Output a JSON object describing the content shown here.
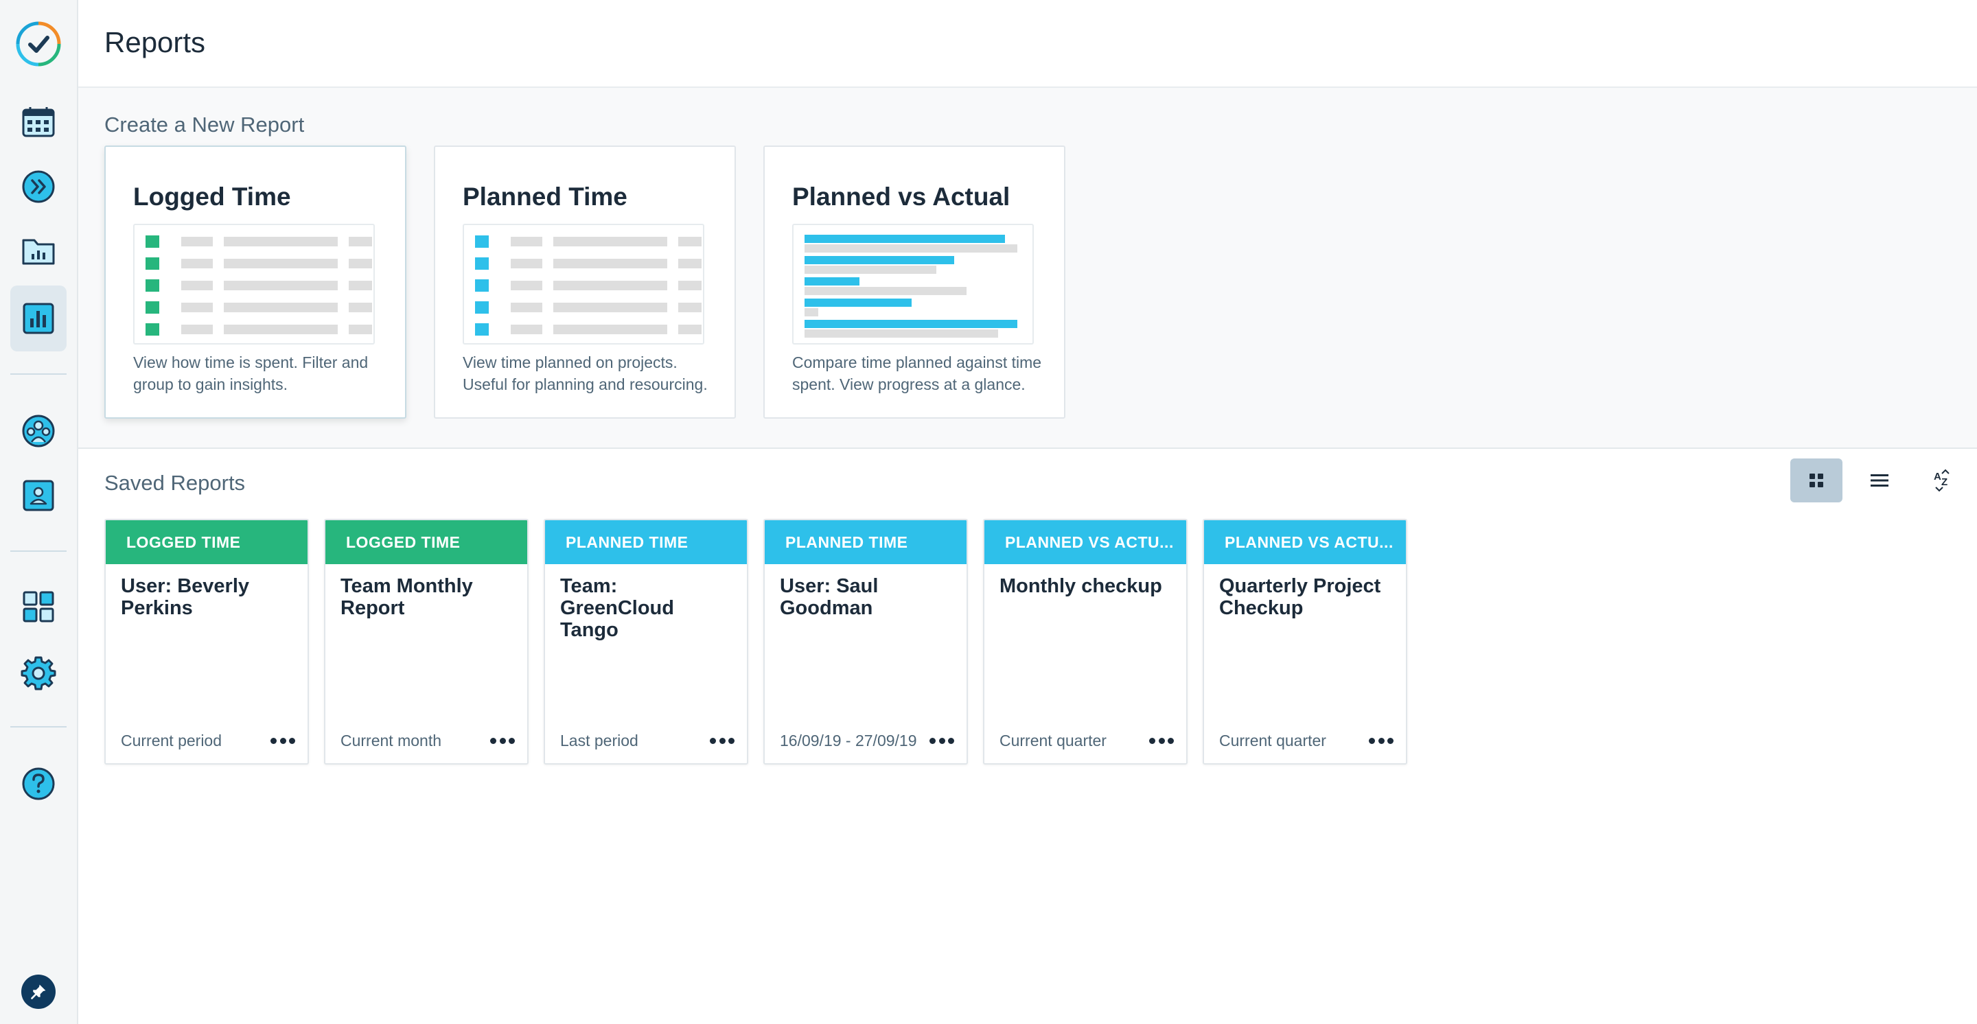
{
  "page": {
    "title": "Reports"
  },
  "colors": {
    "logged": "#27b67d",
    "planned": "#2ec0ea",
    "sidebar_icon": "#1aa3d6",
    "text_dark": "#1c2b3a",
    "text_muted": "#4f6677"
  },
  "sidebar": {
    "items": [
      {
        "icon": "logo-check-icon"
      },
      {
        "icon": "calendar-icon"
      },
      {
        "icon": "double-chevron-right-icon"
      },
      {
        "icon": "folder-chart-icon"
      },
      {
        "icon": "bar-chart-icon",
        "active": true
      },
      {
        "icon": "team-icon"
      },
      {
        "icon": "user-card-icon"
      },
      {
        "icon": "grid-icon"
      },
      {
        "icon": "gear-icon"
      },
      {
        "icon": "help-icon"
      },
      {
        "icon": "pin-icon"
      }
    ]
  },
  "create": {
    "title": "Create a New Report",
    "cards": [
      {
        "title": "Logged Time",
        "description": "View how time is spent. Filter and group to gain insights."
      },
      {
        "title": "Planned Time",
        "description": "View time planned on projects. Useful for planning and resourcing."
      },
      {
        "title": "Planned vs Actual",
        "description": "Compare time planned against time spent. View progress at a glance."
      }
    ]
  },
  "saved": {
    "title": "Saved Reports",
    "view_icons": [
      "grid-view-icon",
      "list-view-icon",
      "sort-az-icon"
    ],
    "reports": [
      {
        "tag": "LOGGED TIME",
        "title": "User: Beverly Perkins",
        "period": "Current period"
      },
      {
        "tag": "LOGGED TIME",
        "title": "Team Monthly Report",
        "period": "Current month"
      },
      {
        "tag": "PLANNED TIME",
        "title": "Team: GreenCloud Tango",
        "period": "Last period"
      },
      {
        "tag": "PLANNED TIME",
        "title": "User: Saul Goodman",
        "period": "16/09/19 - 27/09/19"
      },
      {
        "tag": "PLANNED VS ACTU...",
        "title": "Monthly checkup",
        "period": "Current quarter"
      },
      {
        "tag": "PLANNED VS ACTU...",
        "title": "Quarterly Project Checkup",
        "period": "Current quarter"
      }
    ]
  }
}
